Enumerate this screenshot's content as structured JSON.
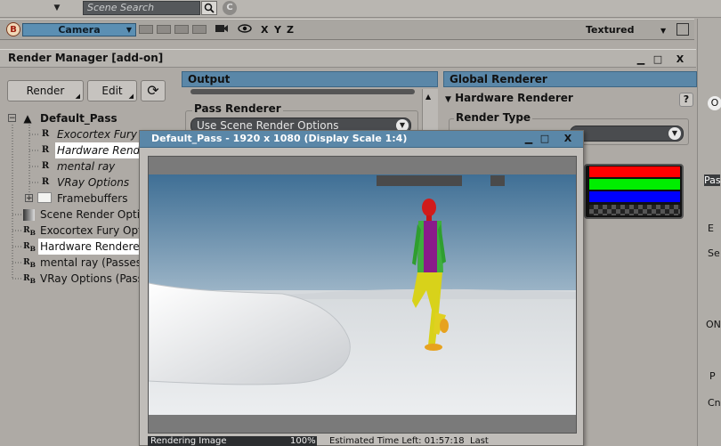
{
  "toolbar": {
    "search_placeholder": "Scene Search",
    "search_icon": "magnifier-icon",
    "c_button": "C"
  },
  "viewport": {
    "badge": "B",
    "camera": "Camera",
    "axes": [
      "X",
      "Y",
      "Z"
    ],
    "display_mode": "Textured"
  },
  "render_manager": {
    "title": "Render Manager [add-on]",
    "buttons": {
      "render": "Render",
      "edit": "Edit"
    },
    "tree": [
      {
        "label": "Default_Pass",
        "level": 0,
        "icon": "pass-icon",
        "bold": true
      },
      {
        "label": "Exocortex Fury Pass",
        "level": 1,
        "icon": "R",
        "italic": true
      },
      {
        "label": "Hardware Renderer",
        "level": 1,
        "icon": "R",
        "italic": true,
        "selected": true
      },
      {
        "label": "mental ray",
        "level": 1,
        "icon": "R",
        "italic": true
      },
      {
        "label": "VRay Options",
        "level": 1,
        "icon": "R",
        "italic": true
      },
      {
        "label": "Framebuffers",
        "level": 1,
        "icon": "folder-icon"
      },
      {
        "label": "Scene Render Options",
        "level": 0,
        "icon": "scene-options-icon"
      },
      {
        "label": "Exocortex Fury Options",
        "level": 0,
        "icon": "RB"
      },
      {
        "label": "Hardware Renderer",
        "level": 0,
        "icon": "RB",
        "selected": true
      },
      {
        "label": "mental ray (Passes)",
        "level": 0,
        "icon": "RB"
      },
      {
        "label": "VRay Options (Passes)",
        "level": 0,
        "icon": "RB"
      }
    ]
  },
  "output_panel": {
    "header": "Output",
    "pass_renderer_label": "Pass Renderer",
    "pass_renderer_value": "Use Scene Render Options"
  },
  "global_panel": {
    "header": "Global Renderer",
    "section": "Hardware Renderer",
    "help": "?",
    "render_type_label": "Render Type",
    "color_bars": [
      "#ff0000",
      "#00ee00",
      "#0000ff",
      "#ffffff"
    ]
  },
  "render_view": {
    "title": "Default_Pass -  1920 x 1080 (Display Scale 1:4)",
    "status_label": "Rendering Image",
    "progress_percent": "100%",
    "progress": 1.0,
    "time_left": "Estimated Time Left: 01:57:18",
    "last": "Last"
  },
  "right_strip": {
    "items": [
      "O",
      "Pass",
      "E",
      "Se",
      "ON",
      "P",
      "Cn"
    ]
  }
}
